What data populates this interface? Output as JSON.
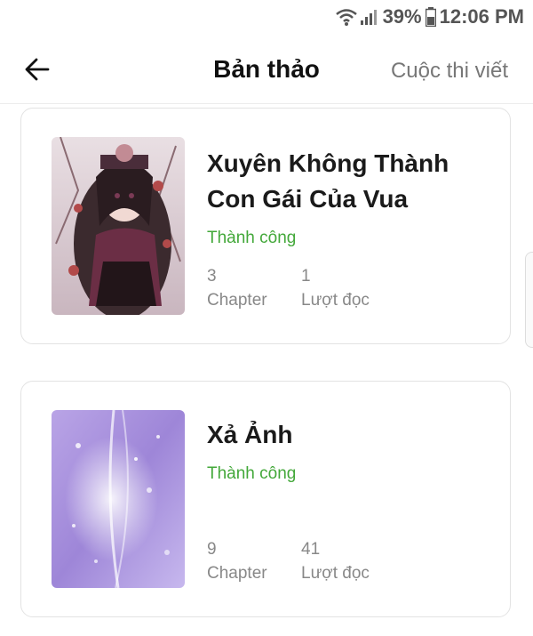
{
  "status_bar": {
    "battery_percent": "39%",
    "time": "12:06 PM"
  },
  "header": {
    "title": "Bản thảo",
    "contest_link": "Cuộc thi viết"
  },
  "stories": [
    {
      "title_line1": "Xuyên Không Thành",
      "title_line2": "Con Gái Của Vua",
      "status": "Thành công",
      "chapters_count": "3",
      "chapters_label": "Chapter",
      "reads_count": "1",
      "reads_label": "Lượt đọc"
    },
    {
      "title_line1": "Xả Ảnh",
      "status": "Thành công",
      "chapters_count": "9",
      "chapters_label": "Chapter",
      "reads_count": "41",
      "reads_label": "Lượt đọc"
    }
  ],
  "colors": {
    "status_success": "#43a83a",
    "muted_text": "#888888"
  }
}
